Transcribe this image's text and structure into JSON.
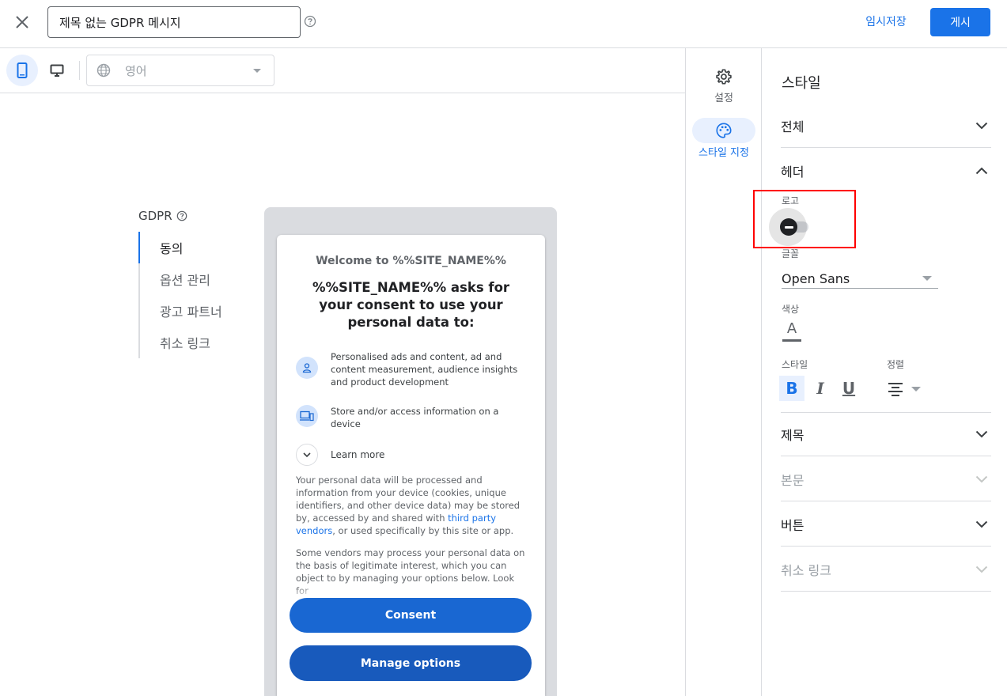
{
  "topbar": {
    "title_value": "제목 없는 GDPR 메시지",
    "draft_label": "임시저장",
    "publish_label": "게시"
  },
  "toolbar": {
    "language": "영어"
  },
  "left_nav": {
    "section_label": "GDPR",
    "items": [
      {
        "label": "동의",
        "active": true
      },
      {
        "label": "옵션 관리",
        "active": false
      },
      {
        "label": "광고 파트너",
        "active": false
      },
      {
        "label": "취소 링크",
        "active": false
      }
    ]
  },
  "preview": {
    "welcome": "Welcome to %%SITE_NAME%%",
    "headline": "%%SITE_NAME%% asks for your consent to use your personal data to:",
    "purposes": [
      {
        "icon": "person-icon",
        "text": "Personalised ads and content, ad and content measurement, audience insights and product development"
      },
      {
        "icon": "devices-icon",
        "text": "Store and/or access information on a device"
      }
    ],
    "learn_more": "Learn more",
    "para1_before": "Your personal data will be processed and information from your device (cookies, unique identifiers, and other device data) may be stored by, accessed by and shared with ",
    "para1_link": "third party vendors",
    "para1_after": ", or used specifically by this site or app.",
    "para2": "Some vendors may process your personal data on the basis of legitimate interest, which you can object to by managing your options below. Look for",
    "consent_label": "Consent",
    "manage_label": "Manage options"
  },
  "rail": {
    "settings_label": "설정",
    "style_label": "스타일 지정"
  },
  "panel": {
    "title": "스타일",
    "sections": {
      "overall": "전체",
      "header": "헤더",
      "title": "제목",
      "body": "본문",
      "buttons": "버튼",
      "cancel_link": "취소 링크"
    },
    "logo_label": "로고",
    "logo_enabled": false,
    "font_label": "글꼴",
    "font_value": "Open Sans",
    "color_label": "색상",
    "color_glyph": "A",
    "style_label": "스타일",
    "align_label": "정렬",
    "bold_glyph": "B",
    "italic_glyph": "I",
    "underline_glyph": "U"
  },
  "colors": {
    "accent": "#1a73e8",
    "highlight": "#ff0000"
  }
}
